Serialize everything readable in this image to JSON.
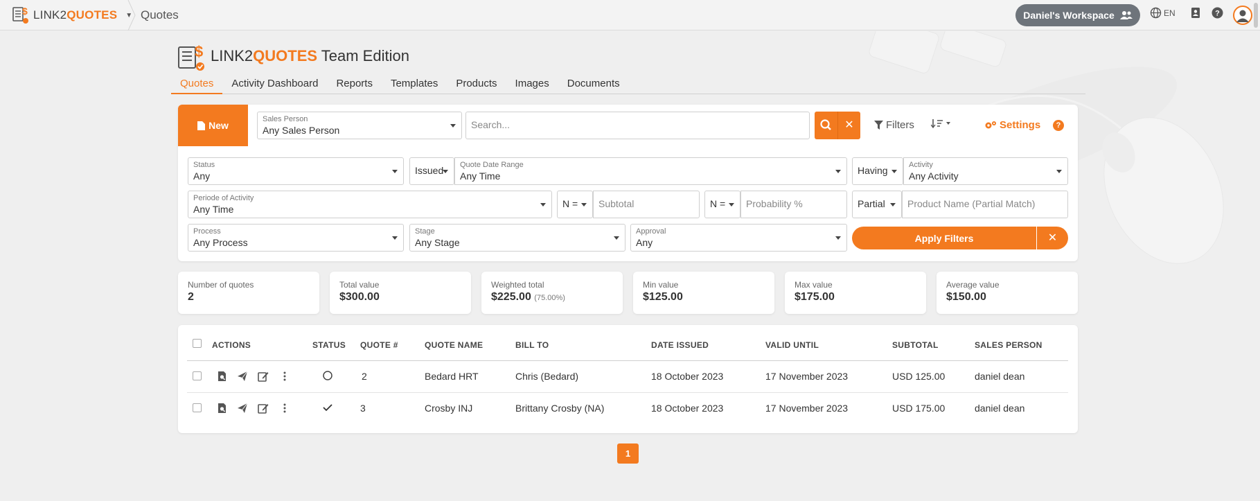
{
  "topbar": {
    "brand_left": "LINK2",
    "brand_right": "QUOTES",
    "breadcrumb": "Quotes",
    "workspace": "Daniel's Workspace",
    "language": "EN",
    "icons": [
      "globe-icon",
      "contact-book-icon",
      "help-icon",
      "user-avatar-icon"
    ]
  },
  "header": {
    "title_left": "LINK2",
    "title_right": "QUOTES",
    "title_suffix": " Team Edition"
  },
  "tabs": [
    {
      "label": "Quotes",
      "active": true
    },
    {
      "label": "Activity Dashboard",
      "active": false
    },
    {
      "label": "Reports",
      "active": false
    },
    {
      "label": "Templates",
      "active": false
    },
    {
      "label": "Products",
      "active": false
    },
    {
      "label": "Images",
      "active": false
    },
    {
      "label": "Documents",
      "active": false
    }
  ],
  "toolbar": {
    "new_label": "New",
    "sales_person_label": "Sales Person",
    "sales_person_value": "Any Sales Person",
    "search_placeholder": "Search...",
    "filters_label": "Filters",
    "settings_label": "Settings"
  },
  "filters": {
    "status_label": "Status",
    "status_value": "Any",
    "issued_label": "Issued",
    "quote_date_label": "Quote Date Range",
    "quote_date_value": "Any Time",
    "having_label": "Having",
    "activity_label": "Activity",
    "activity_value": "Any Activity",
    "period_label": "Periode of Activity",
    "period_value": "Any Time",
    "subtotal_op": "N =",
    "subtotal_placeholder": "Subtotal",
    "probability_op": "N =",
    "probability_placeholder": "Probability %",
    "partial_label": "Partial",
    "product_placeholder": "Product Name (Partial Match)",
    "process_label": "Process",
    "process_value": "Any Process",
    "stage_label": "Stage",
    "stage_value": "Any Stage",
    "approval_label": "Approval",
    "approval_value": "Any",
    "apply_label": "Apply Filters"
  },
  "stats": [
    {
      "label": "Number of quotes",
      "value": "2",
      "sub": ""
    },
    {
      "label": "Total value",
      "value": "$300.00",
      "sub": ""
    },
    {
      "label": "Weighted total",
      "value": "$225.00",
      "sub": "(75.00%)"
    },
    {
      "label": "Min value",
      "value": "$125.00",
      "sub": ""
    },
    {
      "label": "Max value",
      "value": "$175.00",
      "sub": ""
    },
    {
      "label": "Average value",
      "value": "$150.00",
      "sub": ""
    }
  ],
  "table": {
    "headers": [
      "ACTIONS",
      "STATUS",
      "QUOTE #",
      "QUOTE NAME",
      "BILL TO",
      "DATE ISSUED",
      "VALID UNTIL",
      "SUBTOTAL",
      "SALES PERSON"
    ],
    "rows": [
      {
        "status": "open-circle",
        "number": "2",
        "name": "Bedard HRT",
        "bill_to": "Chris (Bedard)",
        "date_issued": "18 October 2023",
        "valid_until": "17 November 2023",
        "subtotal": "USD 125.00",
        "sales_person": "daniel dean"
      },
      {
        "status": "checkmark",
        "number": "3",
        "name": "Crosby INJ",
        "bill_to": "Brittany Crosby (NA)",
        "date_issued": "18 October 2023",
        "valid_until": "17 November 2023",
        "subtotal": "USD 175.00",
        "sales_person": "daniel dean"
      }
    ]
  },
  "pagination": {
    "current": "1"
  },
  "colors": {
    "accent": "#f37a1f",
    "workspace_bg": "#6e747b",
    "background": "#efefef"
  }
}
